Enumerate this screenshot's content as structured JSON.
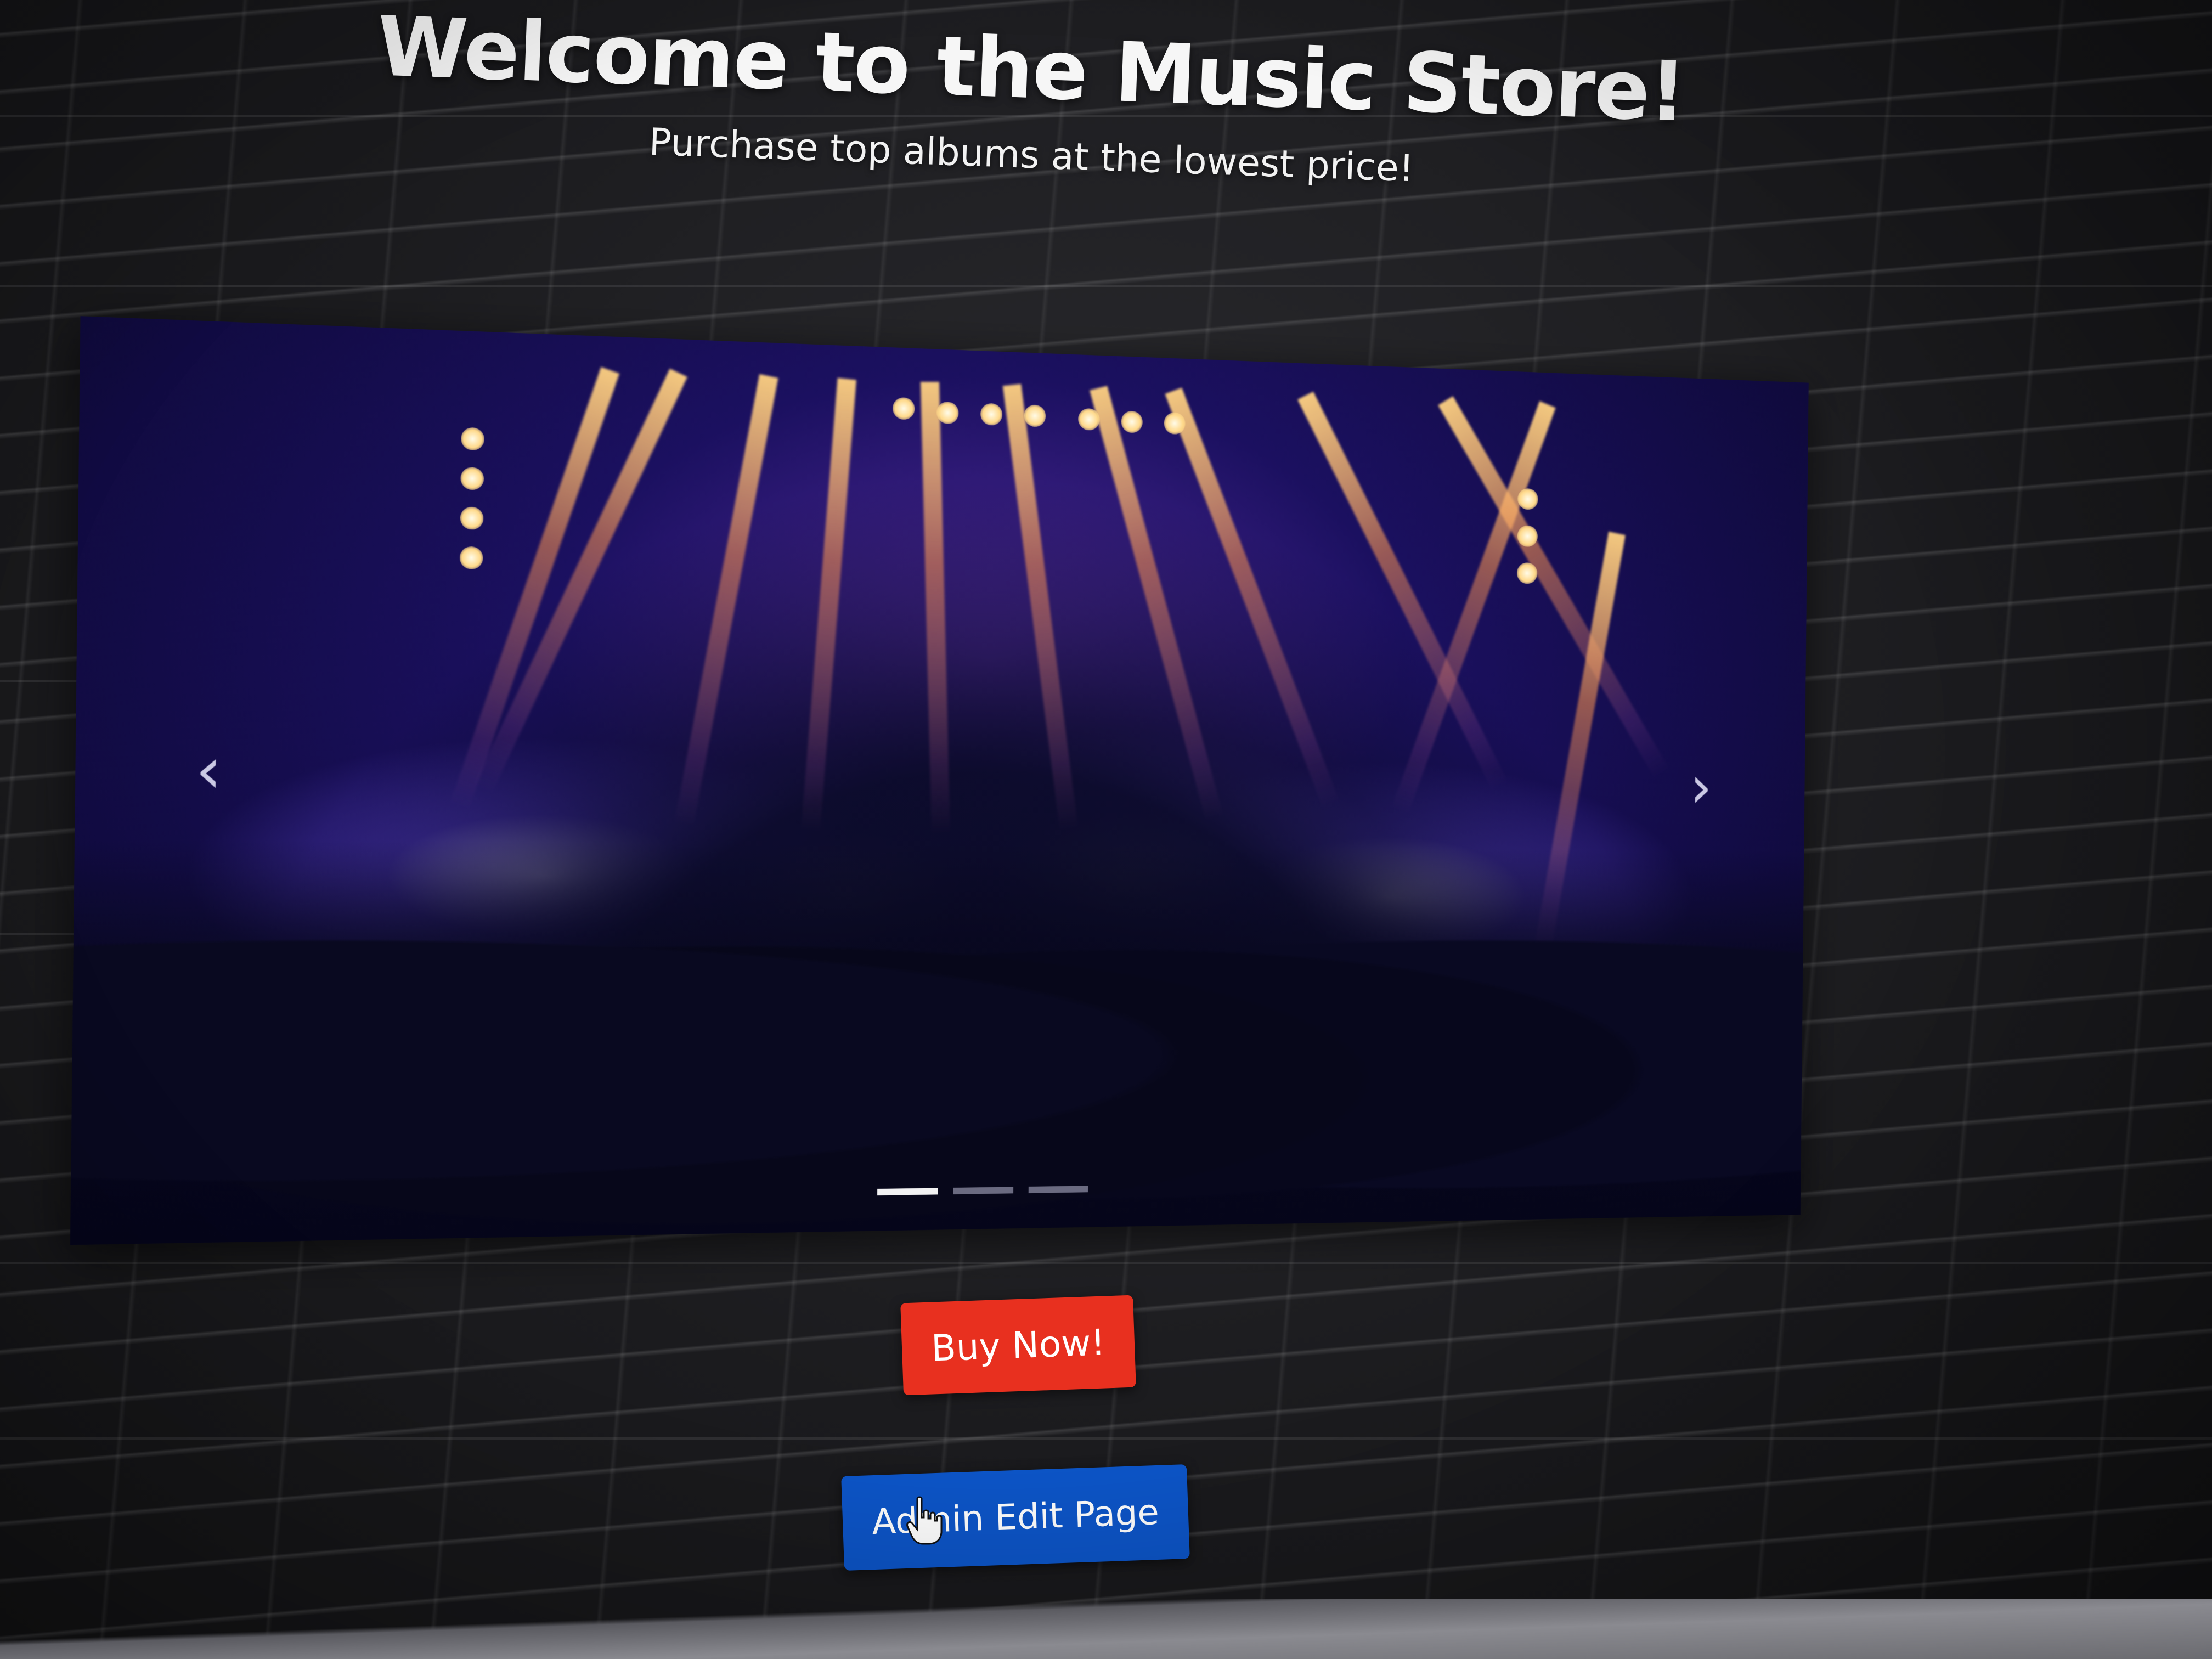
{
  "header": {
    "title": "Welcome to the Music Store!",
    "subtitle": "Purchase top albums at the lowest price!"
  },
  "carousel": {
    "slide_count": 3,
    "active_slide": 0,
    "image_description_icon": "concert-stage-lights-image",
    "prev_icon": "‹",
    "next_icon": "›"
  },
  "actions": {
    "buy_label": "Buy Now!",
    "admin_label": "Admin Edit Page"
  },
  "colors": {
    "buy_button": "#e8301f",
    "admin_button": "#0d55c8",
    "background": "#1c1c1e",
    "title_text": "#f6f6f6"
  },
  "cursor": {
    "icon": "hand-pointer-icon"
  }
}
